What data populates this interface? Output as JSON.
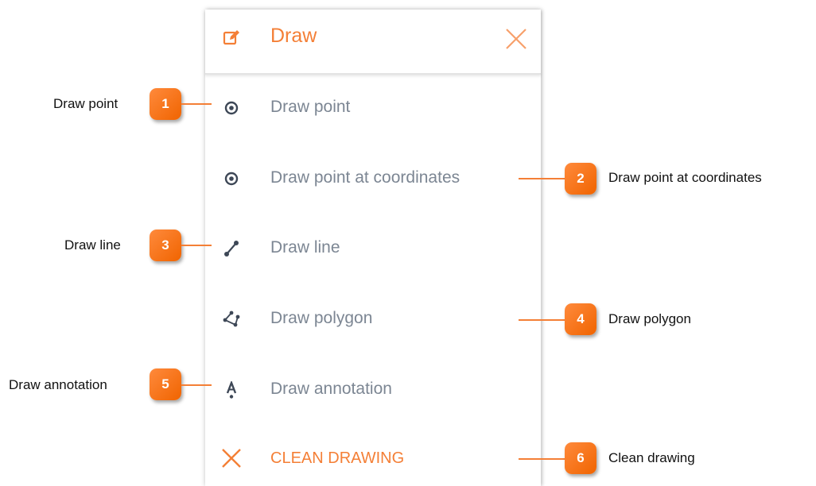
{
  "panel": {
    "title": "Draw",
    "header_icon": "edit-icon",
    "close_icon": "close-icon",
    "items": [
      {
        "label": "Draw point",
        "icon": "point-icon"
      },
      {
        "label": "Draw point at coordinates",
        "icon": "point-icon"
      },
      {
        "label": "Draw line",
        "icon": "line-icon"
      },
      {
        "label": "Draw polygon",
        "icon": "polygon-icon"
      },
      {
        "label": "Draw annotation",
        "icon": "annotation-icon"
      },
      {
        "label": "CLEAN DRAWING",
        "icon": "close-icon"
      }
    ]
  },
  "callouts": [
    {
      "number": "1",
      "label": "Draw point"
    },
    {
      "number": "2",
      "label": "Draw point at coordinates"
    },
    {
      "number": "3",
      "label": "Draw line"
    },
    {
      "number": "4",
      "label": "Draw polygon"
    },
    {
      "number": "5",
      "label": "Draw annotation"
    },
    {
      "number": "6",
      "label": "Clean drawing"
    }
  ],
  "colors": {
    "accent": "#f47f36",
    "item_text": "#7c8693",
    "icon": "#3d4756",
    "badge": "#f06400"
  }
}
